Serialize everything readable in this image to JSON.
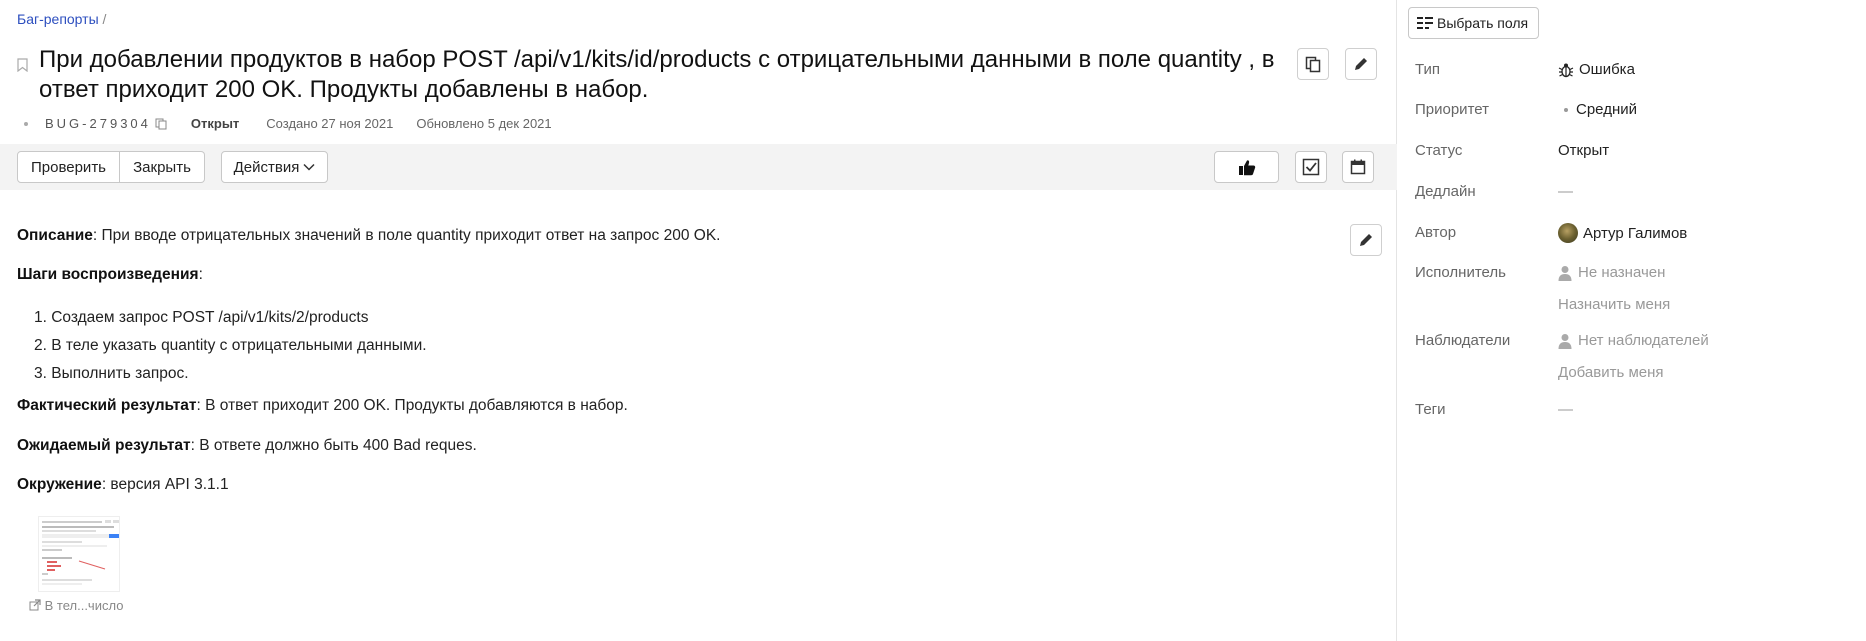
{
  "breadcrumb": {
    "link": "Баг-репорты",
    "separator": "/"
  },
  "issue": {
    "title": "При добавлении продуктов в набор POST /api/v1/kits/id/products с отрицательными данными в поле quantity , в ответ приходит 200 OK. Продукты добавлены в набор.",
    "id": "BUG-279304",
    "status": "Открыт",
    "created": "Создано 27 ноя 2021",
    "updated": "Обновлено 5 дек 2021"
  },
  "toolbar": {
    "check_label": "Проверить",
    "close_label": "Закрыть",
    "actions_label": "Действия"
  },
  "description": {
    "description_label": "Описание",
    "description_text": ": При вводе отрицательных значений в поле quantity приходит ответ на запрос 200 OK.",
    "steps_label": "Шаги воспроизведения",
    "steps_suffix": ":",
    "steps": [
      "1. Создаем запрос POST /api/v1/kits/2/products",
      "2. В теле указать quantity с отрицательными данными.",
      "3. Выполнить запрос."
    ],
    "actual_label": "Фактический результат",
    "actual_text": ": В ответ приходит 200 OK. Продукты добавляются в набор.",
    "expected_label": "Ожидаемый результат",
    "expected_text": ": В ответе должно быть 400 Bad reques.",
    "env_label": "Окружение",
    "env_text": ": версия API 3.1.1",
    "attachment_caption": "В тел...число"
  },
  "sidebar": {
    "choose_fields_label": "Выбрать поля",
    "type_label": "Тип",
    "type_value": "Ошибка",
    "priority_label": "Приоритет",
    "priority_value": "Средний",
    "status_label": "Статус",
    "status_value": "Открыт",
    "deadline_label": "Дедлайн",
    "deadline_value": "—",
    "author_label": "Автор",
    "author_value": "Артур Галимов",
    "assignee_label": "Исполнитель",
    "assignee_value": "Не назначен",
    "assign_me": "Назначить меня",
    "watchers_label": "Наблюдатели",
    "watchers_value": "Нет наблюдателей",
    "add_me": "Добавить меня",
    "tags_label": "Теги",
    "tags_value": "—"
  },
  "colors": {
    "link": "#2d4fbf",
    "toolbar_bg": "#f3f3f3"
  }
}
